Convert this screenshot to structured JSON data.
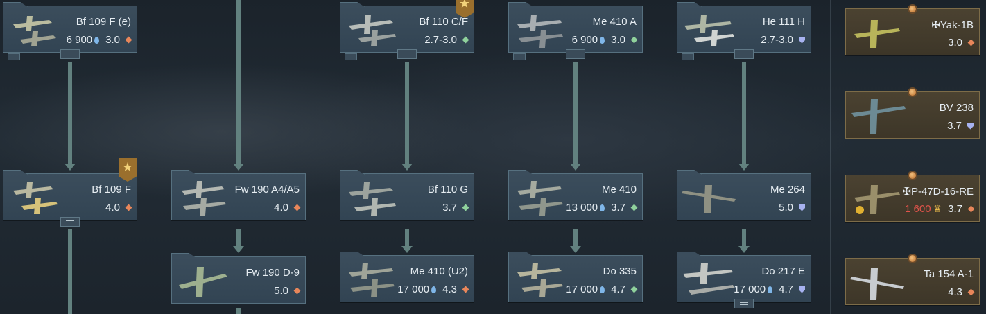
{
  "tree": {
    "vehicles": [
      {
        "id": "bf109fe",
        "name": "Bf 109 F (e)",
        "price": "6 900",
        "br": "3.0",
        "mode_icon": "orange-diamond-icon"
      },
      {
        "id": "bf110cf",
        "name": "Bf 110 C/F",
        "price": "",
        "br": "2.7-3.0",
        "mode_icon": "green-diamond-icon",
        "badge": "star-badge-icon"
      },
      {
        "id": "me410a",
        "name": "Me 410 A",
        "price": "6 900",
        "br": "3.0",
        "mode_icon": "green-diamond-icon"
      },
      {
        "id": "he111h",
        "name": "He 111 H",
        "price": "",
        "br": "2.7-3.0",
        "mode_icon": "shield-icon"
      },
      {
        "id": "yak1b",
        "name": "✠Yak-1B",
        "price": "",
        "br": "3.0",
        "mode_icon": "orange-diamond-icon",
        "premium": true
      },
      {
        "id": "bv238",
        "name": "BV 238",
        "price": "",
        "br": "3.7",
        "mode_icon": "shield-icon",
        "premium": true
      },
      {
        "id": "bf109f",
        "name": "Bf 109 F",
        "price": "",
        "br": "4.0",
        "mode_icon": "orange-diamond-icon",
        "badge": "star-badge-icon"
      },
      {
        "id": "fw190a4",
        "name": "Fw 190 A4/A5",
        "price": "",
        "br": "4.0",
        "mode_icon": "orange-diamond-icon"
      },
      {
        "id": "bf110g",
        "name": "Bf 110 G",
        "price": "",
        "br": "3.7",
        "mode_icon": "green-diamond-icon"
      },
      {
        "id": "me410",
        "name": "Me 410",
        "price": "13 000",
        "br": "3.7",
        "mode_icon": "green-diamond-icon"
      },
      {
        "id": "me264",
        "name": "Me 264",
        "price": "",
        "br": "5.0",
        "mode_icon": "shield-icon"
      },
      {
        "id": "p47d",
        "name": "✠P-47D-16-RE",
        "price": "1 600",
        "price_color": "#e0534a",
        "br": "3.7",
        "mode_icon": "orange-diamond-icon",
        "premium": true,
        "currency_icon": "golden-eagle-icon"
      },
      {
        "id": "fw190d9",
        "name": "Fw 190 D-9",
        "price": "",
        "br": "5.0",
        "mode_icon": "orange-diamond-icon"
      },
      {
        "id": "me410u2",
        "name": "Me 410 (U2)",
        "price": "17 000",
        "br": "4.3",
        "mode_icon": "orange-diamond-icon"
      },
      {
        "id": "do335",
        "name": "Do 335",
        "price": "17 000",
        "br": "4.7",
        "mode_icon": "green-diamond-icon"
      },
      {
        "id": "do217e",
        "name": "Do 217 E",
        "price": "17 000",
        "br": "4.7",
        "mode_icon": "shield-icon"
      },
      {
        "id": "ta154a1",
        "name": "Ta 154 A-1",
        "price": "",
        "br": "4.3",
        "mode_icon": "orange-diamond-icon",
        "premium": true
      }
    ]
  },
  "colors": {
    "connector": "#62817f",
    "card_bg": "#3b4d5c",
    "premium_bg": "#4b4231",
    "text": "#e6edf2",
    "price_red": "#e0534a",
    "diamond_orange": "#e8865a",
    "diamond_green": "#8fd19c",
    "shield": "#a7b2f0"
  }
}
